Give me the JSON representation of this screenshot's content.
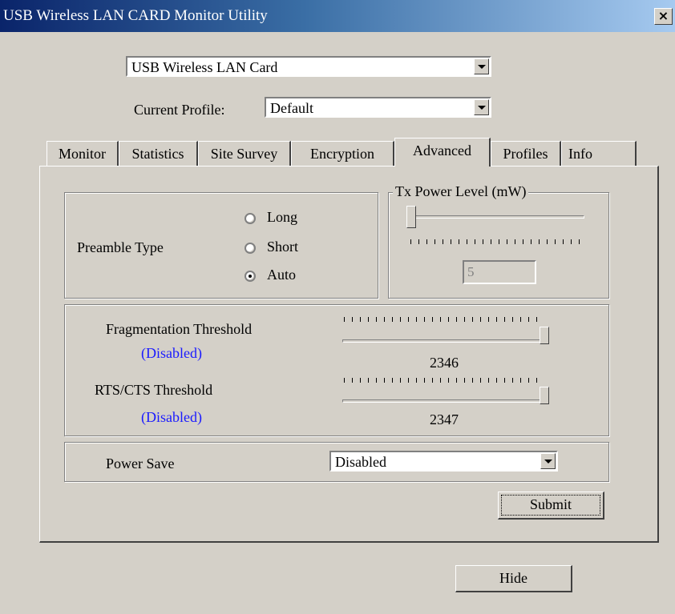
{
  "window": {
    "title": "USB Wireless LAN CARD Monitor Utility",
    "close_label": "×"
  },
  "adapter_select": {
    "value": "USB Wireless LAN Card"
  },
  "profile": {
    "label": "Current Profile:",
    "value": "Default"
  },
  "tabs": [
    {
      "label": "Monitor",
      "active": false
    },
    {
      "label": "Statistics",
      "active": false
    },
    {
      "label": "Site Survey",
      "active": false
    },
    {
      "label": "Encryption",
      "active": false
    },
    {
      "label": "Advanced",
      "active": true
    },
    {
      "label": "Profiles",
      "active": false
    },
    {
      "label": "Info",
      "active": false
    }
  ],
  "preamble": {
    "label": "Preamble Type",
    "options": [
      {
        "label": "Long",
        "checked": false
      },
      {
        "label": "Short",
        "checked": false
      },
      {
        "label": "Auto",
        "checked": true
      }
    ]
  },
  "tx_power": {
    "label": "Tx Power Level (mW)",
    "value": "5",
    "slider_fraction": 0.0
  },
  "fragmentation": {
    "label": "Fragmentation Threshold",
    "status": "(Disabled)",
    "value": "2346",
    "slider_fraction": 1.0
  },
  "rts_cts": {
    "label": "RTS/CTS Threshold",
    "status": "(Disabled)",
    "value": "2347",
    "slider_fraction": 1.0
  },
  "power_save": {
    "label": "Power Save",
    "value": "Disabled"
  },
  "buttons": {
    "submit": "Submit",
    "hide": "Hide"
  }
}
